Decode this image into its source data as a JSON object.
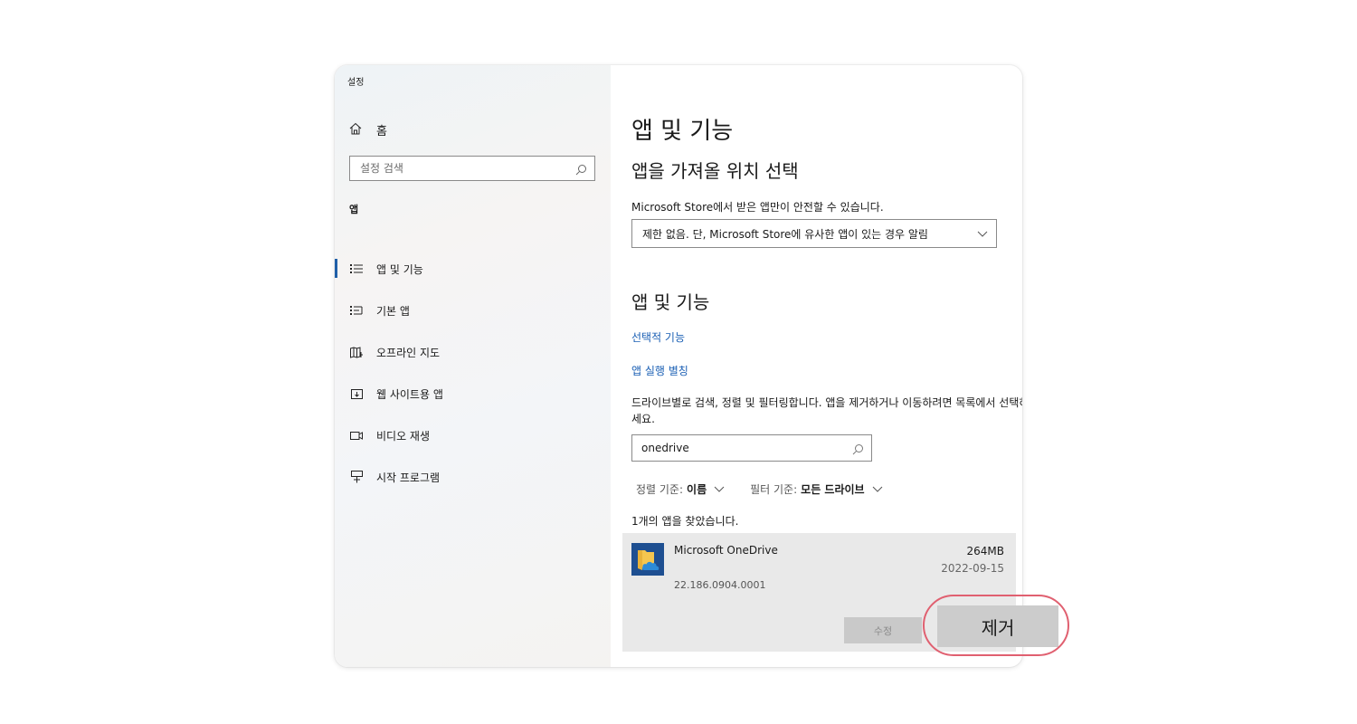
{
  "window": {
    "title": "설정"
  },
  "sidebar": {
    "home": {
      "label": "홈",
      "icon": "home-icon"
    },
    "search": {
      "placeholder": "설정 검색",
      "icon": "search-icon"
    },
    "section_title": "앱",
    "items": [
      {
        "label": "앱 및 기능",
        "icon": "apps-features-icon",
        "active": true
      },
      {
        "label": "기본 앱",
        "icon": "default-apps-icon",
        "active": false
      },
      {
        "label": "오프라인 지도",
        "icon": "map-icon",
        "active": false
      },
      {
        "label": "웹 사이트용 앱",
        "icon": "website-apps-icon",
        "active": false
      },
      {
        "label": "비디오 재생",
        "icon": "video-icon",
        "active": false
      },
      {
        "label": "시작 프로그램",
        "icon": "startup-icon",
        "active": false
      }
    ]
  },
  "main": {
    "title": "앱 및 기능",
    "install_section": {
      "title": "앱을 가져올 위치 선택",
      "description": "Microsoft Store에서 받은 앱만이 안전할 수 있습니다.",
      "dropdown_value": "제한 없음. 단, Microsoft Store에 유사한 앱이 있는 경우 알림"
    },
    "apps_section": {
      "title": "앱 및 기능",
      "link_optional": "선택적 기능",
      "link_alias": "앱 실행 별칭",
      "description": "드라이브별로 검색, 정렬 및 필터링합니다. 앱을 제거하거나 이동하려면 목록에서 선택하세요.",
      "search_value": "onedrive",
      "sort_label": "정렬 기준:",
      "sort_value": "이름",
      "filter_label": "필터 기준:",
      "filter_value": "모든 드라이브",
      "result_count": "1개의 앱을 찾았습니다."
    },
    "app": {
      "name": "Microsoft OneDrive",
      "size": "264MB",
      "date": "2022-09-15",
      "version": "22.186.0904.0001",
      "modify_label": "수정",
      "remove_label": "제거"
    }
  },
  "colors": {
    "accent": "#1f5fa8",
    "link": "#1a5fb4",
    "highlight": "#e06070"
  }
}
